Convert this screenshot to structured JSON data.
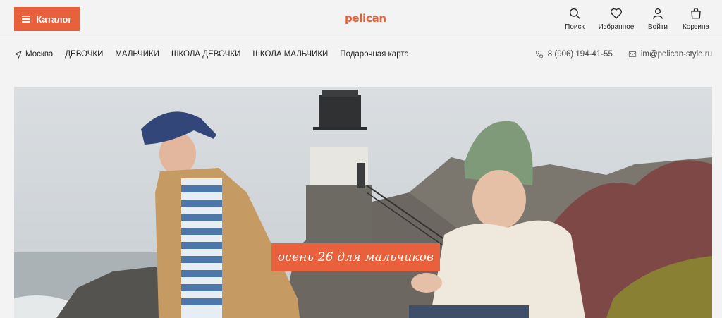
{
  "header": {
    "catalog_label": "Каталог",
    "logo": "pelican",
    "actions": [
      {
        "label": "Поиск",
        "icon": "search-icon"
      },
      {
        "label": "Избранное",
        "icon": "heart-icon"
      },
      {
        "label": "Войти",
        "icon": "user-icon"
      },
      {
        "label": "Корзина",
        "icon": "bag-icon"
      }
    ]
  },
  "nav": {
    "city": "Москва",
    "links": [
      "ДЕВОЧКИ",
      "МАЛЬЧИКИ",
      "ШКОЛА ДЕВОЧКИ",
      "ШКОЛА МАЛЬЧИКИ",
      "Подарочная карта"
    ],
    "phone": "8 (906) 194-41-55",
    "email": "im@pelican-style.ru"
  },
  "banner": {
    "promo_text": "осень 26 для мальчиков"
  },
  "colors": {
    "accent": "#e8603c"
  }
}
